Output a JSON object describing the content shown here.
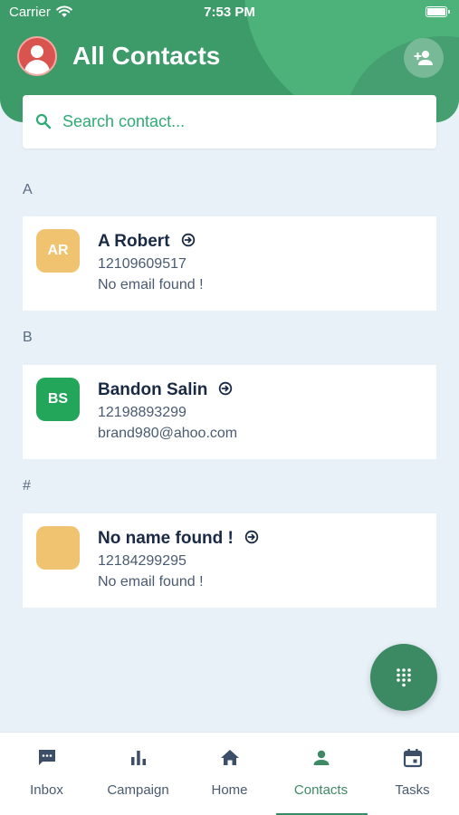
{
  "status_bar": {
    "carrier": "Carrier",
    "time": "7:53 PM"
  },
  "header": {
    "title": "All Contacts"
  },
  "search": {
    "placeholder": "Search contact..."
  },
  "sections": [
    {
      "letter": "A",
      "contacts": [
        {
          "initials": "AR",
          "color": "#efc36f",
          "name": "A Robert",
          "phone": "12109609517",
          "email": "No email found !"
        }
      ]
    },
    {
      "letter": "B",
      "contacts": [
        {
          "initials": "BS",
          "color": "#24a65a",
          "name": "Bandon Salin",
          "phone": "12198893299",
          "email": "brand980@ahoo.com"
        }
      ]
    },
    {
      "letter": "#",
      "contacts": [
        {
          "initials": "",
          "color": "#efc36f",
          "name": "No name found !",
          "phone": "12184299295",
          "email": "No email found !"
        }
      ]
    }
  ],
  "tabs": [
    {
      "label": "Inbox",
      "icon": "inbox-icon",
      "active": false
    },
    {
      "label": "Campaign",
      "icon": "bar-chart-icon",
      "active": false
    },
    {
      "label": "Home",
      "icon": "home-icon",
      "active": false
    },
    {
      "label": "Contacts",
      "icon": "person-icon",
      "active": true
    },
    {
      "label": "Tasks",
      "icon": "calendar-icon",
      "active": false
    }
  ],
  "colors": {
    "brand": "#3d9b6a",
    "accent": "#3d8a64",
    "background": "#e8f0f8"
  }
}
